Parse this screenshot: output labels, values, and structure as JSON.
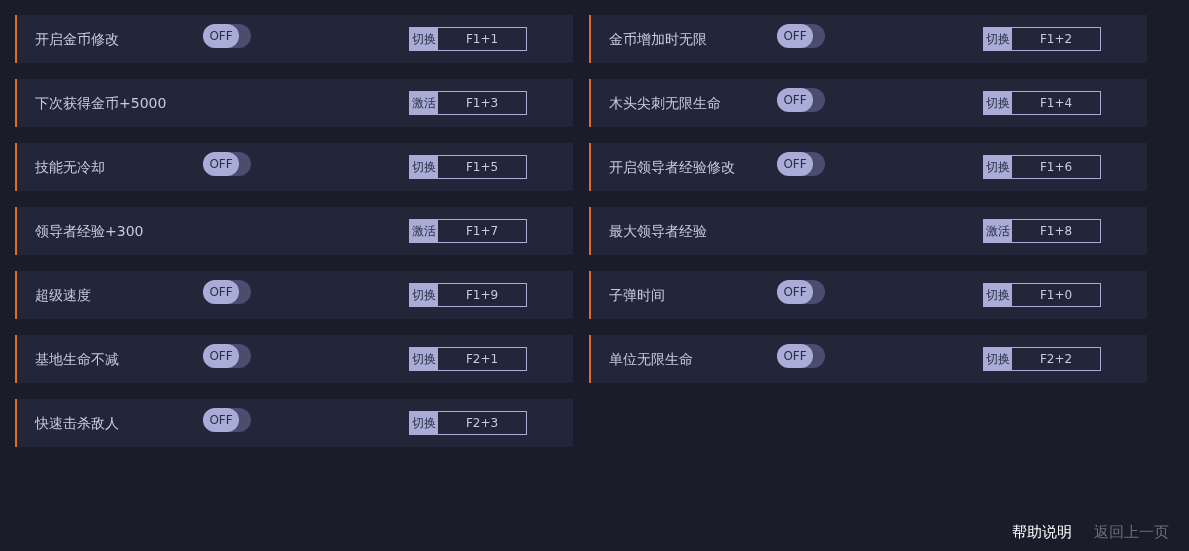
{
  "cheats": [
    {
      "kind": "toggle",
      "label": "开启金币修改",
      "toggle": {
        "on": false,
        "text": "OFF"
      },
      "action": "切换",
      "hotkey": "F1+1"
    },
    {
      "kind": "toggle",
      "label": "金币增加时无限",
      "toggle": {
        "on": false,
        "text": "OFF"
      },
      "action": "切换",
      "hotkey": "F1+2"
    },
    {
      "kind": "button",
      "label": "下次获得金币+5000",
      "action": "激活",
      "hotkey": "F1+3"
    },
    {
      "kind": "toggle",
      "label": "木头尖刺无限生命",
      "toggle": {
        "on": false,
        "text": "OFF"
      },
      "action": "切换",
      "hotkey": "F1+4"
    },
    {
      "kind": "toggle",
      "label": "技能无冷却",
      "toggle": {
        "on": false,
        "text": "OFF"
      },
      "action": "切换",
      "hotkey": "F1+5"
    },
    {
      "kind": "toggle",
      "label": "开启领导者经验修改",
      "toggle": {
        "on": false,
        "text": "OFF"
      },
      "action": "切换",
      "hotkey": "F1+6"
    },
    {
      "kind": "button",
      "label": "领导者经验+300",
      "action": "激活",
      "hotkey": "F1+7"
    },
    {
      "kind": "button",
      "label": "最大领导者经验",
      "action": "激活",
      "hotkey": "F1+8"
    },
    {
      "kind": "toggle",
      "label": "超级速度",
      "toggle": {
        "on": false,
        "text": "OFF"
      },
      "action": "切换",
      "hotkey": "F1+9"
    },
    {
      "kind": "toggle",
      "label": "子弹时间",
      "toggle": {
        "on": false,
        "text": "OFF"
      },
      "action": "切换",
      "hotkey": "F1+0"
    },
    {
      "kind": "toggle",
      "label": "基地生命不减",
      "toggle": {
        "on": false,
        "text": "OFF"
      },
      "action": "切换",
      "hotkey": "F2+1"
    },
    {
      "kind": "toggle",
      "label": "单位无限生命",
      "toggle": {
        "on": false,
        "text": "OFF"
      },
      "action": "切换",
      "hotkey": "F2+2"
    },
    {
      "kind": "toggle",
      "label": "快速击杀敌人",
      "toggle": {
        "on": false,
        "text": "OFF"
      },
      "action": "切换",
      "hotkey": "F2+3"
    }
  ],
  "footer": [
    {
      "label": "帮助说明",
      "selected": true
    },
    {
      "label": "返回上一页",
      "selected": false
    }
  ]
}
